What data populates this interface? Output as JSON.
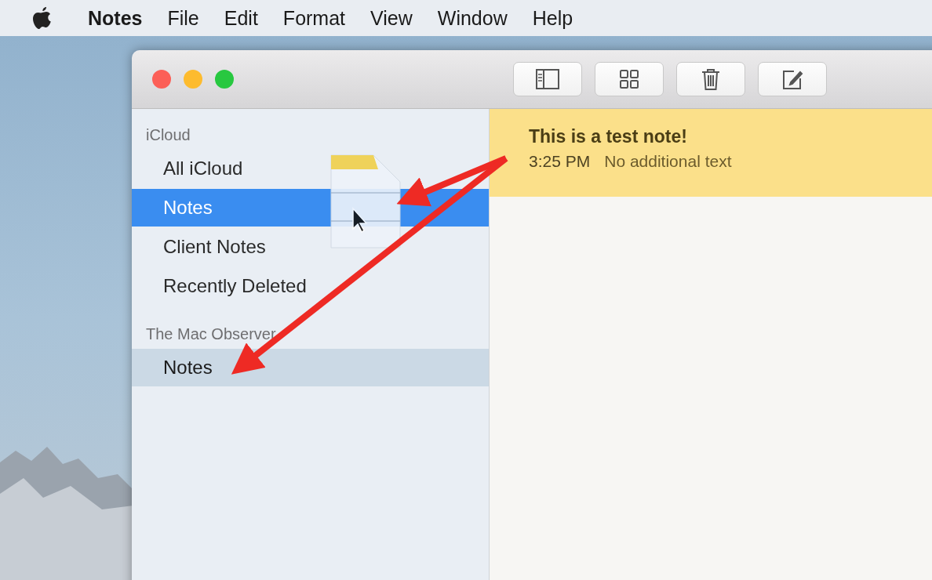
{
  "menu_bar": {
    "items": [
      {
        "label": "Notes",
        "kind": "app"
      },
      {
        "label": "File",
        "kind": "menu"
      },
      {
        "label": "Edit",
        "kind": "menu"
      },
      {
        "label": "Format",
        "kind": "menu"
      },
      {
        "label": "View",
        "kind": "menu"
      },
      {
        "label": "Window",
        "kind": "menu"
      },
      {
        "label": "Help",
        "kind": "menu"
      }
    ]
  },
  "sidebar": {
    "sections": [
      {
        "title": "iCloud",
        "items": [
          {
            "label": "All iCloud",
            "selected": false,
            "drop_target": false
          },
          {
            "label": "Notes",
            "selected": true,
            "drop_target": false
          },
          {
            "label": "Client Notes",
            "selected": false,
            "drop_target": false
          },
          {
            "label": "Recently Deleted",
            "selected": false,
            "drop_target": false
          }
        ]
      },
      {
        "title": "The Mac Observer",
        "items": [
          {
            "label": "Notes",
            "selected": false,
            "drop_target": true
          }
        ]
      }
    ]
  },
  "notes": [
    {
      "title": "This is a test note!",
      "time": "3:25 PM",
      "preview": "No additional text",
      "selected": true
    }
  ]
}
